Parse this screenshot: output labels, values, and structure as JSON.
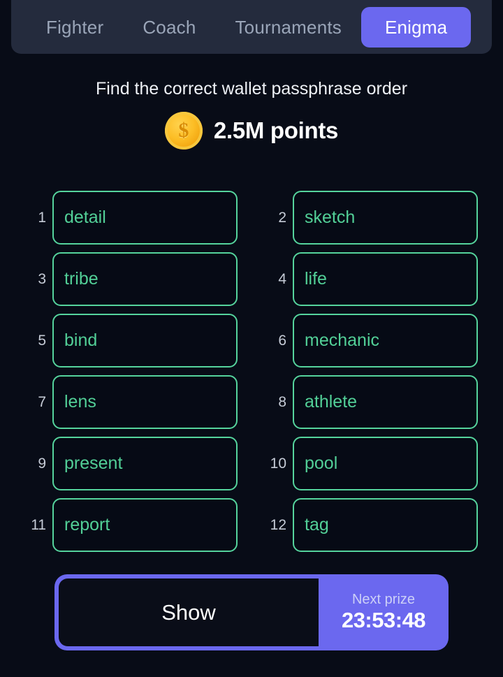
{
  "nav": {
    "tabs": [
      {
        "label": "Fighter",
        "active": false
      },
      {
        "label": "Coach",
        "active": false
      },
      {
        "label": "Tournaments",
        "active": false
      },
      {
        "label": "Enigma",
        "active": true
      }
    ]
  },
  "header": {
    "title": "Find the correct wallet passphrase order",
    "coin_icon": "coin-dollar-icon",
    "coin_symbol": "$",
    "points": "2.5M points"
  },
  "grid": {
    "cells": [
      {
        "index": "1",
        "word": "detail"
      },
      {
        "index": "2",
        "word": "sketch"
      },
      {
        "index": "3",
        "word": "tribe"
      },
      {
        "index": "4",
        "word": "life"
      },
      {
        "index": "5",
        "word": "bind"
      },
      {
        "index": "6",
        "word": "mechanic"
      },
      {
        "index": "7",
        "word": "lens"
      },
      {
        "index": "8",
        "word": "athlete"
      },
      {
        "index": "9",
        "word": "present"
      },
      {
        "index": "10",
        "word": "pool"
      },
      {
        "index": "11",
        "word": "report"
      },
      {
        "index": "12",
        "word": "tag"
      }
    ]
  },
  "footer": {
    "show_label": "Show",
    "prize_label": "Next prize",
    "prize_timer": "23:53:48"
  },
  "colors": {
    "page_background": "#080c17",
    "tabbar_background": "#242b3d",
    "accent_purple": "#6b68ef",
    "word_green": "#52cf97",
    "border_green": "#55d49d",
    "coin_gold": "#f3a712",
    "inactive_tab_text": "#9aa5b8",
    "index_text": "#c5cbd6"
  }
}
